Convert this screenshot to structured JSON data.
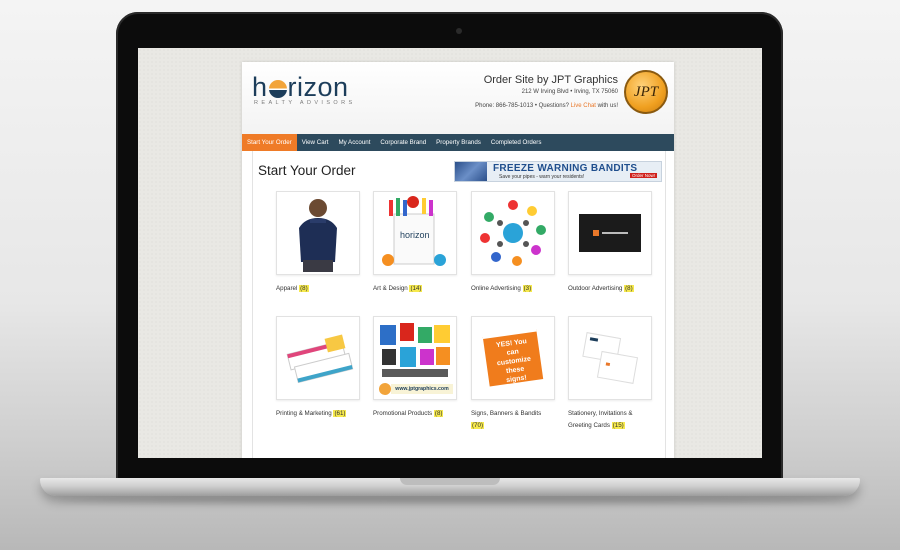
{
  "brand": {
    "logo_text_pre": "h",
    "logo_text_post": "rizon",
    "logo_tagline": "REALTY ADVISORS"
  },
  "header": {
    "order_site": "Order Site by JPT Graphics",
    "address": "212 W Irving Blvd • Irving, TX 75060",
    "phone_prefix": "Phone: 866-785-1013 • Questions? ",
    "live_chat": "Live Chat",
    "phone_suffix": " with us!",
    "badge": "JPT"
  },
  "nav": [
    {
      "label": "Start Your Order",
      "active": true
    },
    {
      "label": "View Cart"
    },
    {
      "label": "My Account"
    },
    {
      "label": "Corporate Brand"
    },
    {
      "label": "Property Brands"
    },
    {
      "label": "Completed Orders"
    }
  ],
  "main": {
    "title": "Start Your Order",
    "banner": {
      "title": "FREEZE WARNING BANDITS",
      "subtitle": "Save your pipes - warn your residents!",
      "button": "Order Now!"
    }
  },
  "categories": [
    {
      "name": "Apparel",
      "count": "(8)",
      "icon": "polo-shirt-person"
    },
    {
      "name": "Art & Design",
      "count": "(14)",
      "icon": "art-supplies"
    },
    {
      "name": "Online Advertising",
      "count": "(3)",
      "icon": "online-icons"
    },
    {
      "name": "Outdoor Advertising",
      "count": "(8)",
      "icon": "doormat"
    },
    {
      "name": "Printing & Marketing",
      "count": "(61)",
      "icon": "business-cards"
    },
    {
      "name": "Promotional Products",
      "count": "(8)",
      "icon": "promo-items",
      "thumb_text": "www.jptgraphics.com"
    },
    {
      "name": "Signs, Banners & Bandits",
      "count": "(70)",
      "icon": "yes-sign",
      "thumb_text": "YES! You can customize these signs!"
    },
    {
      "name": "Stationery, Invitations & Greeting Cards",
      "count": "(15)",
      "icon": "stationery"
    }
  ],
  "colors": {
    "nav_bg": "#2d4a5d",
    "accent": "#ef7b27",
    "brand_navy": "#1c3d5a",
    "count_highlight": "#f6e94d"
  }
}
